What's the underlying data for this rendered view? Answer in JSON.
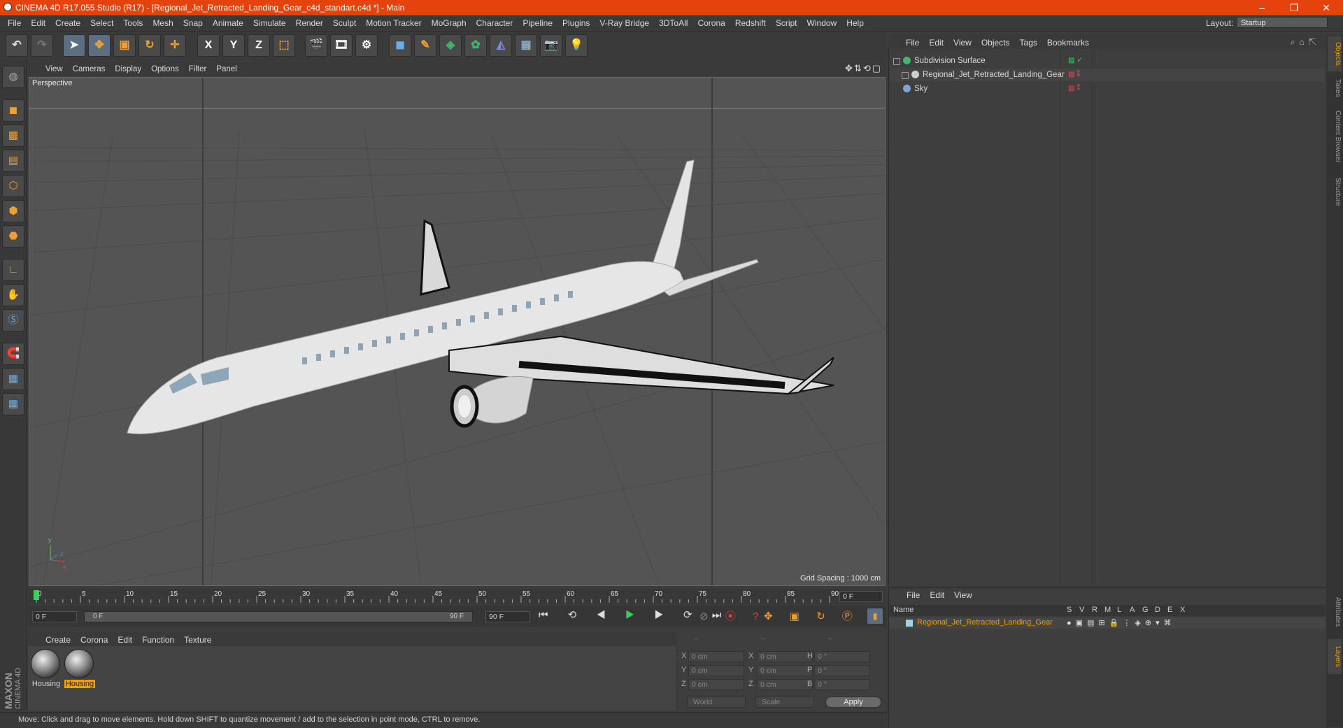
{
  "window": {
    "title": "CINEMA 4D R17.055 Studio (R17) - [Regional_Jet_Retracted_Landing_Gear_c4d_standart.c4d *] - Main",
    "controls": [
      "–",
      "❐",
      "✕"
    ]
  },
  "menubar": {
    "items": [
      "File",
      "Edit",
      "Create",
      "Select",
      "Tools",
      "Mesh",
      "Snap",
      "Animate",
      "Simulate",
      "Render",
      "Sculpt",
      "Motion Tracker",
      "MoGraph",
      "Character",
      "Pipeline",
      "Plugins",
      "V-Ray Bridge",
      "3DToAll",
      "Corona",
      "Redshift",
      "Script",
      "Window",
      "Help"
    ],
    "layout_label": "Layout:",
    "layout_value": "Startup"
  },
  "toolbar": {
    "axis_x": "X",
    "axis_y": "Y",
    "axis_z": "Z"
  },
  "viewport": {
    "menu": [
      "View",
      "Cameras",
      "Display",
      "Options",
      "Filter",
      "Panel"
    ],
    "label": "Perspective",
    "grid_spacing": "Grid Spacing : 1000 cm"
  },
  "timeline": {
    "ticks": [
      "0",
      "5",
      "10",
      "15",
      "20",
      "25",
      "30",
      "35",
      "40",
      "45",
      "50",
      "55",
      "60",
      "65",
      "70",
      "75",
      "80",
      "85",
      "90"
    ],
    "current_frame": "0 F",
    "start": "0 F",
    "range_start": "0 F",
    "range_end": "90 F",
    "end": "90 F"
  },
  "material_manager": {
    "menu": [
      "Create",
      "Corona",
      "Edit",
      "Function",
      "Texture"
    ],
    "materials": [
      {
        "name": "Housing",
        "selected": false
      },
      {
        "name": "Housing",
        "selected": true
      }
    ]
  },
  "coordinates": {
    "header": [
      "--",
      "--",
      "--"
    ],
    "rows": [
      {
        "a": "X",
        "av": "0 cm",
        "b": "X",
        "bv": "0 cm",
        "c": "H",
        "cv": "0 °"
      },
      {
        "a": "Y",
        "av": "0 cm",
        "b": "Y",
        "bv": "0 cm",
        "c": "P",
        "cv": "0 °"
      },
      {
        "a": "Z",
        "av": "0 cm",
        "b": "Z",
        "bv": "0 cm",
        "c": "B",
        "cv": "0 °"
      }
    ],
    "mode1": "World",
    "mode2": "Scale",
    "apply": "Apply"
  },
  "status": {
    "text": "Move: Click and drag to move elements. Hold down SHIFT to quantize movement / add to the selection in point mode, CTRL to remove."
  },
  "object_manager": {
    "menu": [
      "File",
      "Edit",
      "View",
      "Objects",
      "Tags",
      "Bookmarks"
    ],
    "objects": [
      {
        "name": "Subdivision Surface",
        "icon_color": "#3fb86a"
      },
      {
        "name": "Regional_Jet_Retracted_Landing_Gear",
        "icon_color": "#cfcfcf"
      },
      {
        "name": "Sky",
        "icon_color": "#7aa7d8"
      }
    ]
  },
  "layer_manager": {
    "menu": [
      "File",
      "Edit",
      "View"
    ],
    "name_header": "Name",
    "columns": [
      "S",
      "V",
      "R",
      "M",
      "L",
      "A",
      "G",
      "D",
      "E",
      "X"
    ],
    "row_name": "Regional_Jet_Retracted_Landing_Gear",
    "row_color": "#9ad5e8"
  },
  "side_tabs": [
    "Objects",
    "Takes",
    "Content Browser",
    "Structure"
  ],
  "side_tabs_bottom": [
    "Attributes",
    "Layers"
  ],
  "brand": {
    "line1": "MAXON",
    "line2": "CINEMA 4D"
  }
}
